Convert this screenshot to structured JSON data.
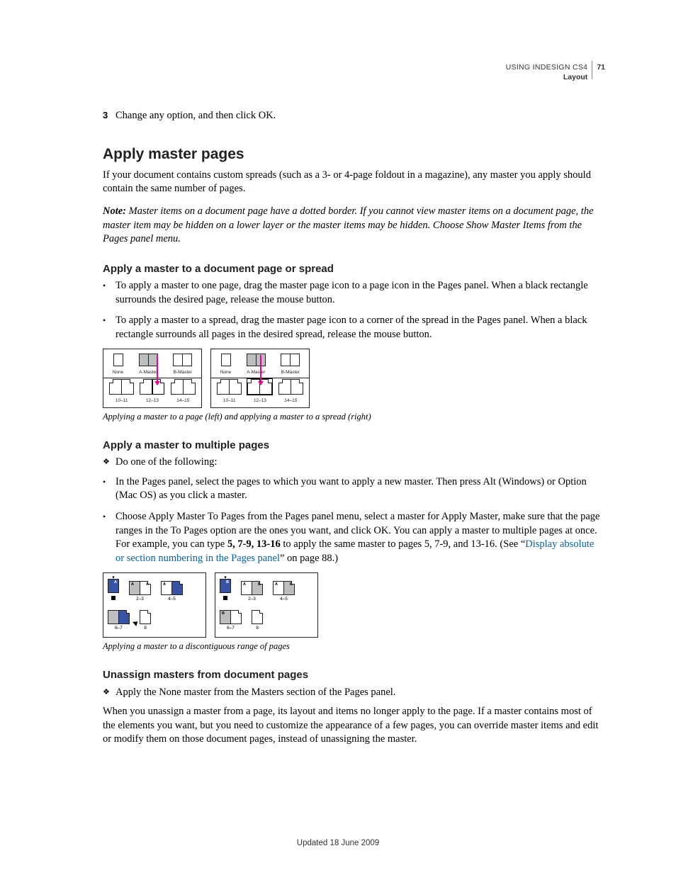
{
  "header": {
    "product": "USING INDESIGN CS4",
    "section": "Layout",
    "page_number": "71"
  },
  "step3": {
    "num": "3",
    "text": "Change any option, and then click OK."
  },
  "h2_apply_master_pages": "Apply master pages",
  "intro_p1": "If your document contains custom spreads (such as a 3- or 4-page foldout in a magazine), any master you apply should contain the same number of pages.",
  "note": {
    "label": "Note:",
    "text": " Master items on a document page have a dotted border. If you cannot view master items on a document page, the master item may be hidden on a lower layer or the master items may be hidden. Choose Show Master Items from the Pages panel menu."
  },
  "h3_apply_page_spread": "Apply a master to a document page or spread",
  "bullets1": {
    "b1": "To apply a master to one page, drag the master page icon to a page icon in the Pages panel. When a black rectangle surrounds the desired page, release the mouse button.",
    "b2": "To apply a master to a spread, drag the master page icon to a corner of the spread in the Pages panel. When a black rectangle surrounds all pages in the desired spread, release the mouse button."
  },
  "fig1": {
    "masters": {
      "none": "None",
      "a": "A-Master",
      "b": "B-Master"
    },
    "pages": {
      "p1": "10–11",
      "p2": "12–13",
      "p3": "14–15"
    },
    "caption": "Applying a master to a page (left) and applying a master to a spread (right)"
  },
  "h3_apply_multiple": "Apply a master to multiple pages",
  "diamond1": "Do one of the following:",
  "bullets2": {
    "b1": "In the Pages panel, select the pages to which you want to apply a new master. Then press Alt (Windows) or Option (Mac OS) as you click a master.",
    "b2_a": "Choose Apply Master To Pages from the Pages panel menu, select a master for Apply Master, make sure that the page ranges in the To Pages option are the ones you want, and click OK. You can apply a master to multiple pages at once. For example, you can type ",
    "b2_bold": "5, 7-9, 13-16",
    "b2_b": " to apply the same master to pages 5, 7-9, and 13-16. (See “",
    "b2_link": "Display absolute or section numbering in the Pages panel",
    "b2_c": "” on page 88.)"
  },
  "fig2": {
    "labels": {
      "p23": "2–3",
      "p45": "4–5",
      "p67": "6–7",
      "p8": "8"
    },
    "tagA": "A",
    "tagB": "B",
    "caption": "Applying a master to a discontiguous range of pages"
  },
  "h3_unassign": "Unassign masters from document pages",
  "diamond2": "Apply the None master from the Masters section of the Pages panel.",
  "unassign_p": "When you unassign a master from a page, its layout and items no longer apply to the page. If a master contains most of the elements you want, but you need to customize the appearance of a few pages, you can override master items and edit or modify them on those document pages, instead of unassigning the master.",
  "footer": "Updated 18 June 2009"
}
